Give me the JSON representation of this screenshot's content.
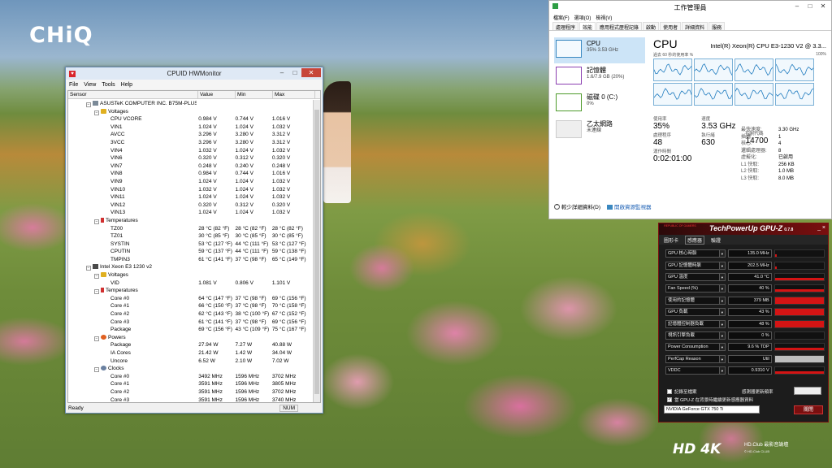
{
  "wallpaper": {
    "logo": "CHiQ",
    "watermark_logo": "HD 4K",
    "watermark_text": "HD.Club 最影音論壇",
    "watermark_small": "© HD.Club",
    "watermark_name": "CLUB"
  },
  "hwmonitor": {
    "title": "CPUID HWMonitor",
    "app_icon": "hwmonitor-icon",
    "menu": [
      "File",
      "View",
      "Tools",
      "Help"
    ],
    "columns": [
      "Sensor",
      "Value",
      "Min",
      "Max"
    ],
    "status": "Ready",
    "num": "NUM",
    "rows": [
      {
        "level": 0,
        "icon": "board",
        "name": "ASUSTeK COMPUTER INC. B75M-PLUS",
        "value": "",
        "min": "",
        "max": ""
      },
      {
        "level": 1,
        "icon": "volt",
        "name": "Voltages",
        "value": "",
        "min": "",
        "max": ""
      },
      {
        "level": 2,
        "name": "CPU VCORE",
        "value": "0.984 V",
        "min": "0.744 V",
        "max": "1.016 V"
      },
      {
        "level": 2,
        "name": "VIN1",
        "value": "1.024 V",
        "min": "1.024 V",
        "max": "1.032 V"
      },
      {
        "level": 2,
        "name": "AVCC",
        "value": "3.296 V",
        "min": "3.280 V",
        "max": "3.312 V"
      },
      {
        "level": 2,
        "name": "3VCC",
        "value": "3.296 V",
        "min": "3.280 V",
        "max": "3.312 V"
      },
      {
        "level": 2,
        "name": "VIN4",
        "value": "1.032 V",
        "min": "1.024 V",
        "max": "1.032 V"
      },
      {
        "level": 2,
        "name": "VIN6",
        "value": "0.320 V",
        "min": "0.312 V",
        "max": "0.320 V"
      },
      {
        "level": 2,
        "name": "VIN7",
        "value": "0.248 V",
        "min": "0.240 V",
        "max": "0.248 V"
      },
      {
        "level": 2,
        "name": "VIN8",
        "value": "0.984 V",
        "min": "0.744 V",
        "max": "1.016 V"
      },
      {
        "level": 2,
        "name": "VIN9",
        "value": "1.024 V",
        "min": "1.024 V",
        "max": "1.032 V"
      },
      {
        "level": 2,
        "name": "VIN10",
        "value": "1.032 V",
        "min": "1.024 V",
        "max": "1.032 V"
      },
      {
        "level": 2,
        "name": "VIN11",
        "value": "1.024 V",
        "min": "1.024 V",
        "max": "1.032 V"
      },
      {
        "level": 2,
        "name": "VIN12",
        "value": "0.320 V",
        "min": "0.312 V",
        "max": "0.320 V"
      },
      {
        "level": 2,
        "name": "VIN13",
        "value": "1.024 V",
        "min": "1.024 V",
        "max": "1.032 V"
      },
      {
        "level": 1,
        "icon": "temp",
        "name": "Temperatures",
        "value": "",
        "min": "",
        "max": ""
      },
      {
        "level": 2,
        "name": "TZ00",
        "value": "28 °C (82 °F)",
        "min": "28 °C (82 °F)",
        "max": "28 °C (82 °F)"
      },
      {
        "level": 2,
        "name": "TZ01",
        "value": "30 °C (85 °F)",
        "min": "30 °C (85 °F)",
        "max": "30 °C (85 °F)"
      },
      {
        "level": 2,
        "name": "SYSTIN",
        "value": "53 °C (127 °F)",
        "min": "44 °C (111 °F)",
        "max": "53 °C (127 °F)"
      },
      {
        "level": 2,
        "name": "CPUTIN",
        "value": "59 °C (137 °F)",
        "min": "44 °C (111 °F)",
        "max": "59 °C (138 °F)"
      },
      {
        "level": 2,
        "name": "TMPIN3",
        "value": "61 °C (141 °F)",
        "min": "37 °C (98 °F)",
        "max": "65 °C (149 °F)"
      },
      {
        "level": 0,
        "icon": "cpu",
        "name": "Intel Xeon E3 1230 v2",
        "value": "",
        "min": "",
        "max": ""
      },
      {
        "level": 1,
        "icon": "volt",
        "name": "Voltages",
        "value": "",
        "min": "",
        "max": ""
      },
      {
        "level": 2,
        "name": "VID",
        "value": "1.081 V",
        "min": "0.806 V",
        "max": "1.101 V"
      },
      {
        "level": 1,
        "icon": "temp",
        "name": "Temperatures",
        "value": "",
        "min": "",
        "max": ""
      },
      {
        "level": 2,
        "name": "Core #0",
        "value": "64 °C (147 °F)",
        "min": "37 °C (98 °F)",
        "max": "69 °C (156 °F)"
      },
      {
        "level": 2,
        "name": "Core #1",
        "value": "66 °C (150 °F)",
        "min": "37 °C (98 °F)",
        "max": "70 °C (158 °F)"
      },
      {
        "level": 2,
        "name": "Core #2",
        "value": "62 °C (143 °F)",
        "min": "38 °C (100 °F)",
        "max": "67 °C (152 °F)"
      },
      {
        "level": 2,
        "name": "Core #3",
        "value": "61 °C (141 °F)",
        "min": "37 °C (98 °F)",
        "max": "69 °C (156 °F)"
      },
      {
        "level": 2,
        "name": "Package",
        "value": "69 °C (156 °F)",
        "min": "43 °C (109 °F)",
        "max": "75 °C (167 °F)"
      },
      {
        "level": 1,
        "icon": "pow",
        "name": "Powers",
        "value": "",
        "min": "",
        "max": ""
      },
      {
        "level": 2,
        "name": "Package",
        "value": "27.94 W",
        "min": "7.27 W",
        "max": "40.88 W"
      },
      {
        "level": 2,
        "name": "IA Cores",
        "value": "21.42 W",
        "min": "1.42 W",
        "max": "34.04 W"
      },
      {
        "level": 2,
        "name": "Uncore",
        "value": "6.52 W",
        "min": "2.10 W",
        "max": "7.02 W"
      },
      {
        "level": 1,
        "icon": "clk",
        "name": "Clocks",
        "value": "",
        "min": "",
        "max": ""
      },
      {
        "level": 2,
        "name": "Core #0",
        "value": "3492 MHz",
        "min": "1596 MHz",
        "max": "3702 MHz"
      },
      {
        "level": 2,
        "name": "Core #1",
        "value": "3591 MHz",
        "min": "1596 MHz",
        "max": "3805 MHz"
      },
      {
        "level": 2,
        "name": "Core #2",
        "value": "3591 MHz",
        "min": "1596 MHz",
        "max": "3702 MHz"
      },
      {
        "level": 2,
        "name": "Core #3",
        "value": "3591 MHz",
        "min": "1596 MHz",
        "max": "3740 MHz"
      }
    ]
  },
  "taskmanager": {
    "title": "工作管理員",
    "menu": [
      "檔案(F)",
      "選項(O)",
      "檢視(V)"
    ],
    "tabs": [
      "處理程序",
      "效能",
      "應用程式歷程記錄",
      "啟動",
      "使用者",
      "詳細資料",
      "服務"
    ],
    "active_tab": 1,
    "side_items": [
      {
        "name": "CPU",
        "value": "35% 3.53 GHz",
        "kind": "cpu"
      },
      {
        "name": "記憶體",
        "value": "1.6/7.9 GB (20%)",
        "kind": "mem"
      },
      {
        "name": "磁碟 0 (C:)",
        "value": "0%",
        "kind": "disk"
      },
      {
        "name": "乙太網路",
        "value": "未連線",
        "kind": "eth"
      }
    ],
    "cpu_label": "CPU",
    "cpu_model": "Intel(R) Xeon(R) CPU E3-1230 V2 @ 3.3...",
    "graph_left_label": "過去 60 秒的使用率 %",
    "graph_right_label": "100%",
    "stats": {
      "util_label": "使用率",
      "util": "35%",
      "speed_label": "速度",
      "speed": "3.53 GHz",
      "proc_label": "處理程序",
      "proc": "48",
      "threads_label": "執行緒",
      "threads": "630",
      "handles_label": "控制代碼",
      "handles": "14700",
      "uptime_label": "運作時間",
      "uptime": "0:02:01:00"
    },
    "specs": [
      {
        "k": "最快速度:",
        "v": "3.30 GHz"
      },
      {
        "k": "插槽:",
        "v": "1"
      },
      {
        "k": "核心:",
        "v": "4"
      },
      {
        "k": "邏輯處理器:",
        "v": "8"
      },
      {
        "k": "虛擬化:",
        "v": "已啟用"
      },
      {
        "k": "L1 快取:",
        "v": "256 KB"
      },
      {
        "k": "L2 快取:",
        "v": "1.0 MB"
      },
      {
        "k": "L3 快取:",
        "v": "8.0 MB"
      }
    ],
    "fewer_details": "較少詳細資料(D)",
    "open_resmon": "開啟資源監視器"
  },
  "gpuz": {
    "title": "TechPowerUp GPU-Z",
    "version": "0.7.8",
    "rog_text": "REPUBLIC OF GAMERS",
    "win_controls": "_ ×",
    "menu": [
      "圖形卡",
      "感應器",
      "驗證"
    ],
    "active_menu": 1,
    "sensors": [
      {
        "label": "GPU 核心時脈",
        "value": "135.0 MHz",
        "fill": 0.03,
        "grey": false,
        "thin": true
      },
      {
        "label": "GPU 記憶體時脈",
        "value": "202.5 MHz",
        "fill": 0.03,
        "grey": false,
        "thin": true
      },
      {
        "label": "GPU 溫度",
        "value": "41.0 °C",
        "fill": 1.0,
        "grey": false,
        "thin": true
      },
      {
        "label": "Fan Speed (%)",
        "value": "40 %",
        "fill": 1.0,
        "grey": false,
        "thin": true
      },
      {
        "label": "使用的記憶體",
        "value": "379 MB",
        "fill": 1.0,
        "grey": false,
        "thin": false
      },
      {
        "label": "GPU 負載",
        "value": "43 %",
        "fill": 1.0,
        "grey": false,
        "thin": false
      },
      {
        "label": "記憶體控制器負載",
        "value": "48 %",
        "fill": 1.0,
        "grey": false,
        "thin": false
      },
      {
        "label": "視訊引擎負載",
        "value": "0 %",
        "fill": 0.0,
        "grey": false,
        "thin": false
      },
      {
        "label": "Power Consumption",
        "value": "9.6 % TDP",
        "fill": 1.0,
        "grey": false,
        "thin": true
      },
      {
        "label": "PerfCap Reason",
        "value": "Util",
        "fill": 1.0,
        "grey": true,
        "thin": false
      },
      {
        "label": "VDDC",
        "value": "0.9310 V",
        "fill": 1.0,
        "grey": false,
        "thin": true
      }
    ],
    "log_label": "記錄至檔案",
    "bg_label": "當 GPU-Z 在背景時繼續更新感應器資料",
    "rate_label": "感測器更新頻率",
    "card": "NVIDIA GeForce GTX 750 Ti",
    "close_label": "關閉"
  }
}
